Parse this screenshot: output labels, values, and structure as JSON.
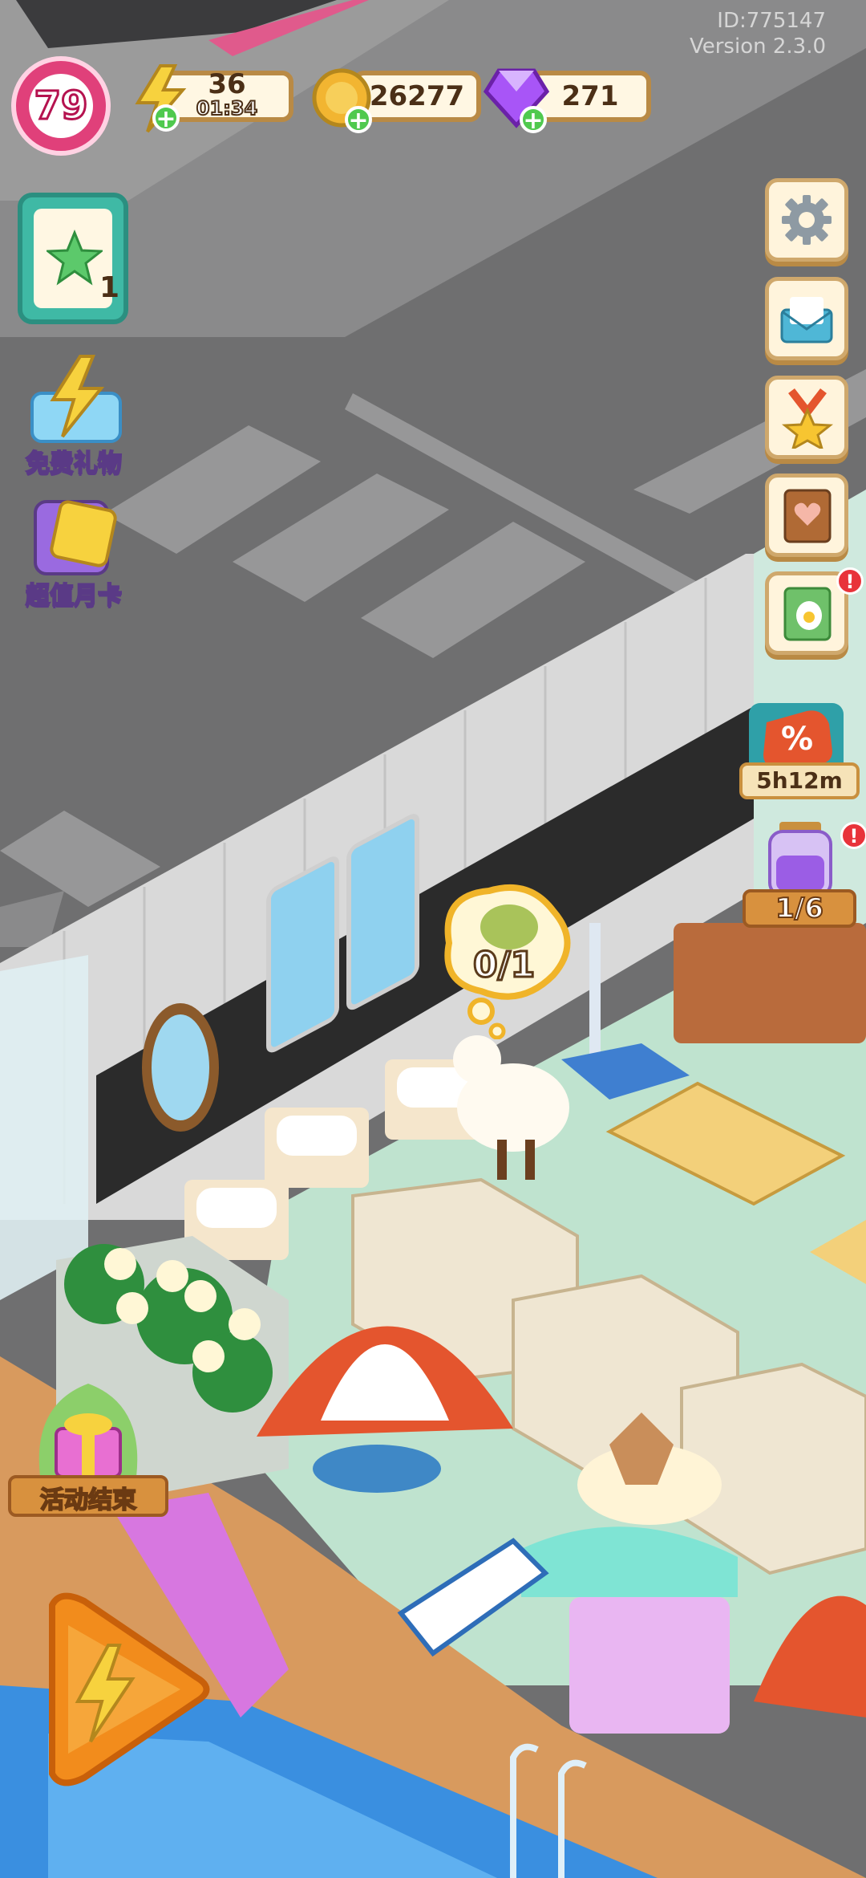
{
  "hud": {
    "level": "79",
    "energy": {
      "value": "36",
      "timer": "01:34"
    },
    "coins": {
      "value": "26277"
    },
    "gems": {
      "value": "271"
    },
    "player_id": "ID:775147",
    "version": "Version 2.3.0"
  },
  "left_menu": {
    "task_badge_count": "1",
    "free_gift_label": "免费礼物",
    "monthly_card_label": "超值月卡",
    "event_label": "活动结束"
  },
  "right_menu": {
    "sale_timer": "5h12m",
    "jar_progress": "1/6"
  },
  "scene": {
    "order_bubble_text": "0/1"
  },
  "colors": {
    "level_ring": "#e0407a",
    "hud_border": "#b98a45",
    "plus_green": "#4fc94e",
    "gem_purple": "#a855f7",
    "coin_gold": "#f2b531",
    "sale_red": "#e4552e",
    "pool_blue": "#3a8fe0"
  }
}
